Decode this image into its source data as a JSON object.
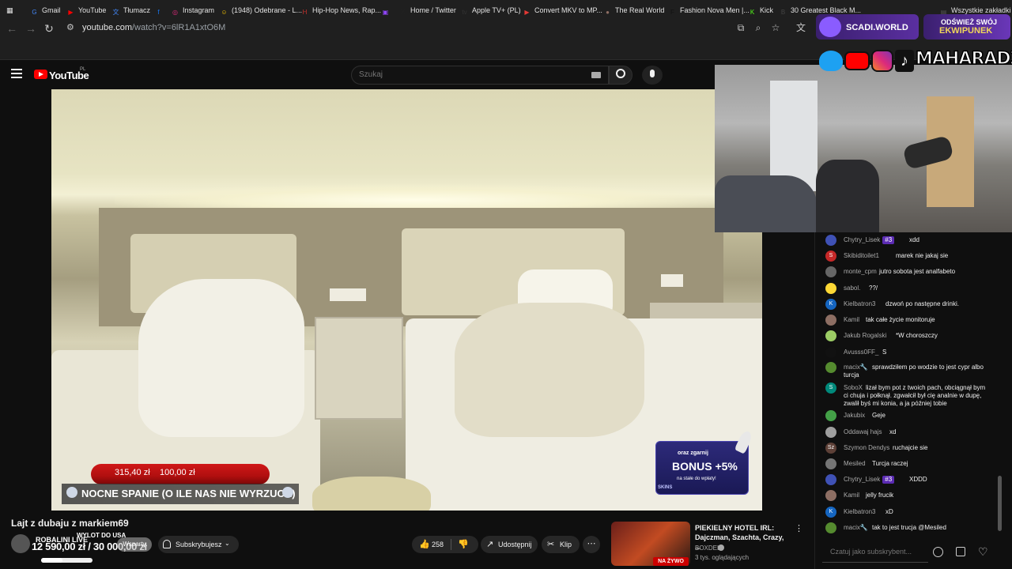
{
  "browser": {
    "url_main": "youtube.com",
    "url_path": "/watch?v=6lR1A1xtO6M",
    "bookmarks": [
      {
        "label": "Gmail",
        "color": "#4285f4",
        "glyph": "G"
      },
      {
        "label": "YouTube",
        "color": "#ff0000",
        "glyph": "▶"
      },
      {
        "label": "Tłumacz",
        "color": "#4285f4",
        "glyph": "文"
      },
      {
        "label": "",
        "color": "#1877f2",
        "glyph": "f"
      },
      {
        "label": "Instagram",
        "color": "#dd2a7b",
        "glyph": "◎"
      },
      {
        "label": "(1948) Odebrane - L...",
        "color": "#f5c400",
        "glyph": "☺"
      },
      {
        "label": "Hip-Hop News, Rap...",
        "color": "#c4302b",
        "glyph": "H"
      },
      {
        "label": "",
        "color": "#9146ff",
        "glyph": "▣"
      },
      {
        "label": "Home / Twitter",
        "color": "#222222",
        "glyph": "X"
      },
      {
        "label": "Apple TV+ (PL)",
        "color": "#333333",
        "glyph": "tv"
      },
      {
        "label": "Convert MKV to MP...",
        "color": "#e53935",
        "glyph": "▶"
      },
      {
        "label": "The Real World",
        "color": "#8d6e63",
        "glyph": "●"
      },
      {
        "label": "Fashion Nova Men |...",
        "color": "#111111",
        "glyph": "F"
      },
      {
        "label": "Kick",
        "color": "#53fc18",
        "glyph": "K"
      },
      {
        "label": "30 Greatest Black M...",
        "color": "#444444",
        "glyph": "B"
      },
      {
        "label": "Wszystkie zakładki",
        "color": "#555555",
        "glyph": "▤"
      }
    ]
  },
  "youtube": {
    "logo_text": "YouTube",
    "region": "PL",
    "search_placeholder": "Szukaj"
  },
  "video": {
    "donation_a": "315,40 zł",
    "donation_b": "100,00 zł",
    "stream_title": "NOCNE SPANIE (O ILE NAS NIE WYRZUCA)",
    "bonus_top": "oraz zgarnij",
    "bonus_mid": "BONUS +5%",
    "bonus_bot": "na stałe do wpłaty!",
    "bonus_brand": "SKINS"
  },
  "overlay": {
    "scadi": "SCADI.WORLD",
    "refresh_1": "ODŚWIEŻ SWÓJ",
    "refresh_2": "EKWIPUNEK",
    "handle": "MAHARADZZA"
  },
  "below_video": {
    "title": "Lajt z dubaju z markiem69",
    "channel_name": "ROBALINI LIVE",
    "goal_label": "WYLOT DO USA",
    "goal_amount": "12 590,00 zł",
    "goal_sep": "/",
    "goal_target": "30 000,00 zł",
    "goal_progress": 0.42,
    "joined": "Wsparty",
    "subscribed": "Subskrybujesz",
    "likes": "258",
    "share": "Udostępnij",
    "clip": "Klip"
  },
  "recommendation": {
    "title": "PIEKIELNY HOTEL IRL: Dajczman, Szachta, Crazy, ...",
    "channel": "BOXDEL",
    "views": "3 tys. oglądających",
    "badge": "NA ŻYWO"
  },
  "chat": {
    "input_placeholder": "Czatuj jako subskrybent...",
    "messages": [
      {
        "name": "Chytry_Lisek",
        "badge": "#3",
        "text": "xdd",
        "avatar_color": "#3f51b5",
        "initial": ""
      },
      {
        "name": "Skibiditoilet1",
        "badge": "",
        "text": "marek nie jakaj sie",
        "avatar_color": "#c62828",
        "initial": "S"
      },
      {
        "name": "monte_cpm",
        "badge": "",
        "text": "jutro sobota jest analfabeto",
        "avatar_color": "#666666",
        "initial": ""
      },
      {
        "name": "sabol.",
        "badge": "",
        "text": "??/",
        "avatar_color": "#fdd835",
        "initial": ""
      },
      {
        "name": "Kielbatron3",
        "badge": "",
        "text": "dzwoń po następne drinki.",
        "avatar_color": "#1565c0",
        "initial": "K"
      },
      {
        "name": "Kamil",
        "badge": "",
        "text": "tak całe życie monitoruje",
        "avatar_color": "#8d6e63",
        "initial": ""
      },
      {
        "name": "Jakub Rogalski",
        "badge": "",
        "text": "*W choroszczy",
        "avatar_color": "#9ccc65",
        "initial": ""
      },
      {
        "name": "Avusss0FF_",
        "badge": "",
        "text": "S",
        "avatar_color": "#111111",
        "initial": ""
      },
      {
        "name": "macix🔧",
        "badge": "",
        "text": "sprawdziłem po wodzie to jest cypr albo",
        "text2": "turcja",
        "avatar_color": "#558b2f",
        "initial": ""
      },
      {
        "name": "SoboX",
        "badge": "",
        "text": "lizał bym pot z twoich pach, obciągnął bym",
        "text2": "ci chuja i połknął. zgwałcił był cię analnie w dupę,",
        "text3": "zwalił byś mi konia, a ja później tobie",
        "avatar_color": "#00897b",
        "initial": "S"
      },
      {
        "name": "Jakubix",
        "badge": "",
        "text": "Geje",
        "avatar_color": "#43a047",
        "initial": ""
      },
      {
        "name": "Oddawaj hajs",
        "badge": "",
        "text": "xd",
        "avatar_color": "#9e9e9e",
        "initial": ""
      },
      {
        "name": "Szymon Dendys",
        "badge": "",
        "text": "ruchajcie sie",
        "avatar_color": "#5d4037",
        "initial": "Sz"
      },
      {
        "name": "Mesiled",
        "badge": "",
        "text": "Turcja raczej",
        "avatar_color": "#757575",
        "initial": ""
      },
      {
        "name": "Chytry_Lisek",
        "badge": "#3",
        "text": "XDDD",
        "avatar_color": "#3f51b5",
        "initial": ""
      },
      {
        "name": "Kamil",
        "badge": "",
        "text": "jelly frucik",
        "avatar_color": "#8d6e63",
        "initial": ""
      },
      {
        "name": "Kielbatron3",
        "badge": "",
        "text": "xD",
        "avatar_color": "#1565c0",
        "initial": "K"
      },
      {
        "name": "macix🔧",
        "badge": "",
        "text": "tak to jest trucja @Mesiled",
        "avatar_color": "#558b2f",
        "initial": ""
      }
    ]
  }
}
